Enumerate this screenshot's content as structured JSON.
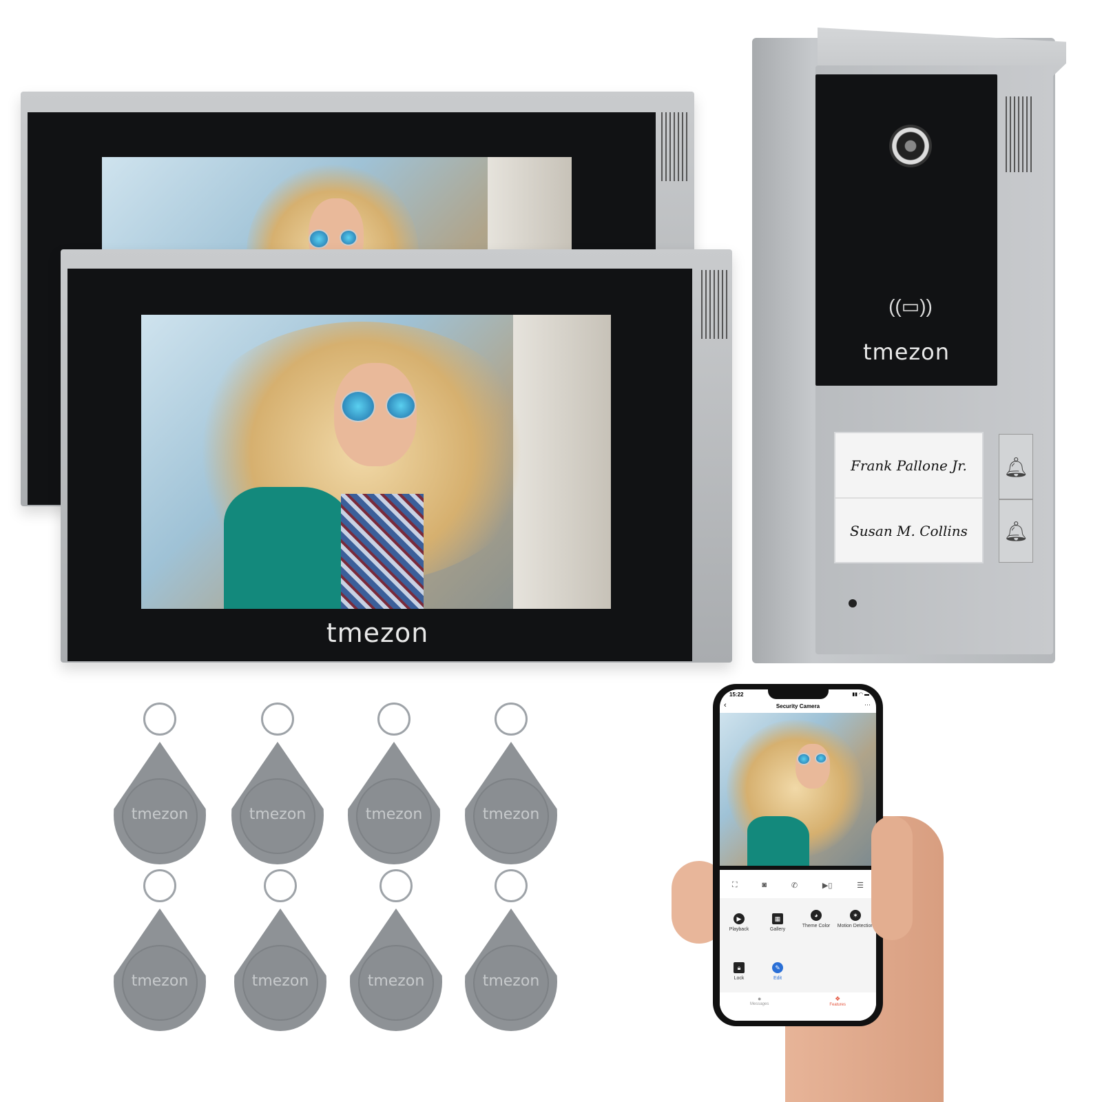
{
  "brand": "tmezon",
  "colors": {
    "bezel": "#111214",
    "frame": "#b8bbbe",
    "fob": "#8e9296",
    "accent_edit": "#2a6fd6",
    "accent_features": "#e4533c"
  },
  "doorbell": {
    "nameplates": [
      "Frank Pallone Jr.",
      "Susan M. Collins"
    ],
    "icons": [
      "camera-lens-icon",
      "rfid-card-icon",
      "bell-icon",
      "bell-icon"
    ]
  },
  "keyfobs": {
    "count": 8,
    "label": "tmezon"
  },
  "phone": {
    "status_time": "15:22",
    "title": "Security Camera",
    "back_icon": "chevron-left-icon",
    "more_icon": "ellipsis-icon",
    "toolbar": [
      "fullscreen-icon",
      "snapshot-icon",
      "call-icon",
      "record-icon",
      "menu-icon"
    ],
    "features": [
      {
        "label": "Playback",
        "icon": "play-icon"
      },
      {
        "label": "Gallery",
        "icon": "image-icon"
      },
      {
        "label": "Theme Color",
        "icon": "palette-icon"
      },
      {
        "label": "Motion Detection",
        "icon": "motion-icon"
      },
      {
        "label": "Lock",
        "icon": "lock-icon"
      },
      {
        "label": "Edit",
        "icon": "edit-icon"
      }
    ],
    "tabs": [
      {
        "label": "Messages",
        "icon": "bell-icon"
      },
      {
        "label": "Features",
        "icon": "features-icon"
      }
    ]
  }
}
